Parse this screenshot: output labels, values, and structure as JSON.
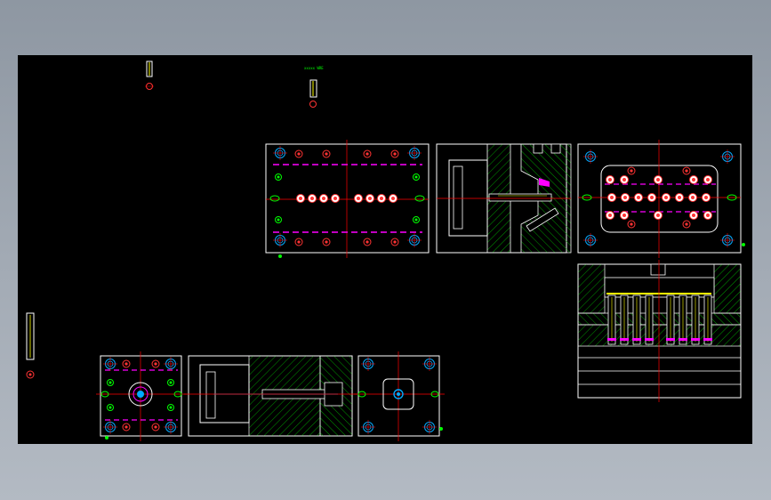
{
  "canvas": {
    "background": "#000000",
    "frame_color": "#ffffff",
    "centerline_color": "#ff0000",
    "parting_line_color": "#ff00ff",
    "hole_color": "#00aaff",
    "screw_color": "#ff3333",
    "pin_color": "#00ff00",
    "hatch_color": "#00ff00",
    "part_color": "#ffff00"
  },
  "annotations": {
    "small_label": "xxxxx WRE"
  }
}
